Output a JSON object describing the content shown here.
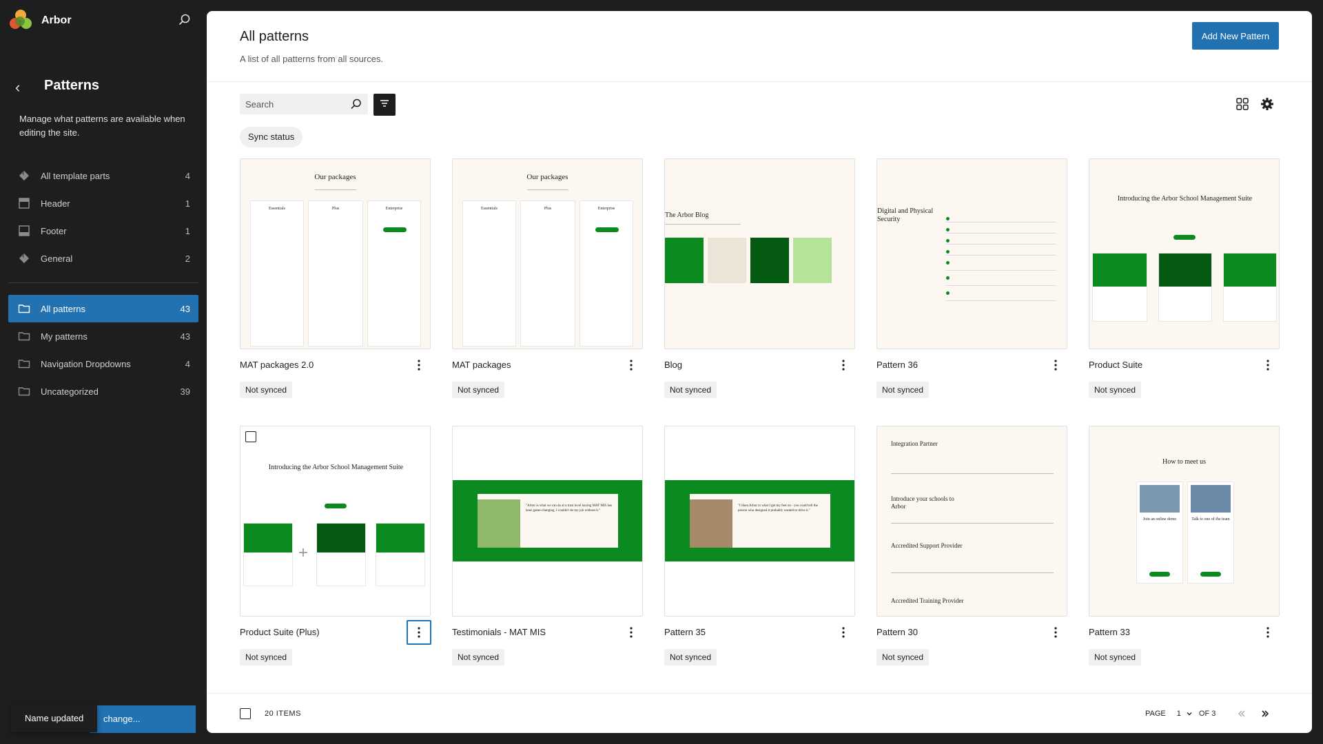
{
  "sidebar": {
    "brand": "Arbor",
    "title": "Patterns",
    "description": "Manage what patterns are available when editing the site.",
    "template_parts": [
      {
        "label": "All template parts",
        "count": "4",
        "icon": "diamond-icon"
      },
      {
        "label": "Header",
        "count": "1",
        "icon": "header-icon"
      },
      {
        "label": "Footer",
        "count": "1",
        "icon": "footer-icon"
      },
      {
        "label": "General",
        "count": "2",
        "icon": "diamond-icon"
      }
    ],
    "pattern_categories": [
      {
        "label": "All patterns",
        "count": "43",
        "active": true
      },
      {
        "label": "My patterns",
        "count": "43"
      },
      {
        "label": "Navigation Dropdowns",
        "count": "4"
      },
      {
        "label": "Uncategorized",
        "count": "39"
      }
    ]
  },
  "snackbar": {
    "message": "Name updated",
    "button_partial": "change..."
  },
  "header": {
    "title": "All patterns",
    "subtitle": "A list of all patterns from all sources.",
    "add_button": "Add New Pattern"
  },
  "toolbar": {
    "search_placeholder": "Search",
    "sync_filter": "Sync status"
  },
  "patterns": [
    {
      "title": "MAT packages 2.0",
      "status": "Not synced",
      "preview": "packages"
    },
    {
      "title": "MAT packages",
      "status": "Not synced",
      "preview": "packages"
    },
    {
      "title": "Blog",
      "status": "Not synced",
      "preview": "blog"
    },
    {
      "title": "Pattern 36",
      "status": "Not synced",
      "preview": "security"
    },
    {
      "title": "Product Suite",
      "status": "Not synced",
      "preview": "suite"
    },
    {
      "title": "Product Suite (Plus)",
      "status": "Not synced",
      "preview": "suite-plus"
    },
    {
      "title": "Testimonials - MAT MIS",
      "status": "Not synced",
      "preview": "testimonial-a"
    },
    {
      "title": "Pattern 35",
      "status": "Not synced",
      "preview": "testimonial-b"
    },
    {
      "title": "Pattern 30",
      "status": "Not synced",
      "preview": "partners"
    },
    {
      "title": "Pattern 33",
      "status": "Not synced",
      "preview": "meet"
    }
  ],
  "previews": {
    "packages_title": "Our packages",
    "packages_cols": [
      "Essentials",
      "Plus",
      "Enterprise"
    ],
    "blog_title": "The Arbor Blog",
    "security_title": "Digital and Physical Security",
    "suite_title": "Introducing the Arbor School Management Suite",
    "testimonial_a_quote": "\"Arbor is what we can do at a trust level having MAT MIS has been game-changing. I couldn't do my job without it.\"",
    "testimonial_b_quote": "\"I liken Arbor to what I get my feet on - you could tell the person who designed it probably wanted to drive it.\"",
    "partners": [
      "Integration Partner",
      "Introduce your schools to Arbor",
      "Accredited Support Provider",
      "Accredited Training Provider"
    ],
    "meet_title": "How to meet us",
    "meet_options": [
      "Join an online demo",
      "Talk to one of the team"
    ]
  },
  "footer": {
    "items": "20 ITEMS",
    "page_label": "PAGE",
    "page_value": "1",
    "of_label": "OF 3"
  },
  "colors": {
    "accent": "#2271b1",
    "sidebar_bg": "#1e1e1e",
    "brand_green": "#0a8a1f"
  }
}
